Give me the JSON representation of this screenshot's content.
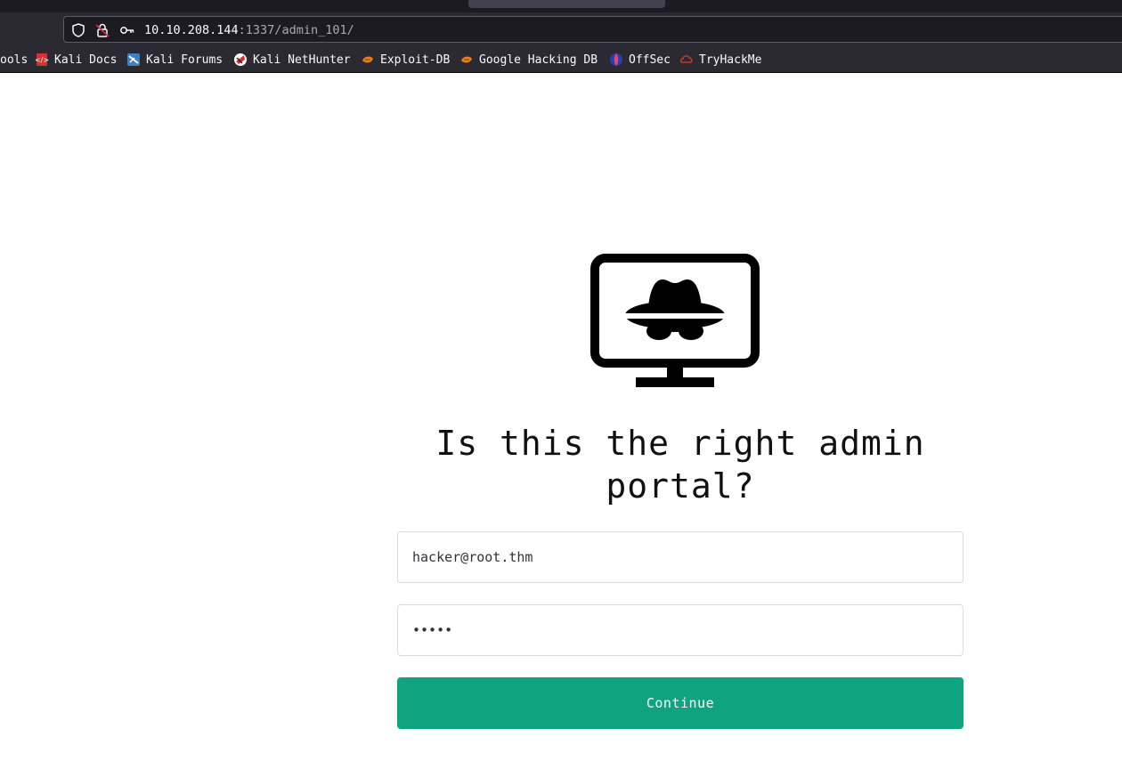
{
  "browser": {
    "url_host": "10.10.208.144",
    "url_path": ":1337/admin_101/",
    "bookmarks": [
      {
        "label": "ools",
        "icon": "tools-icon"
      },
      {
        "label": "Kali Docs",
        "icon": "kali-docs-icon"
      },
      {
        "label": "Kali Forums",
        "icon": "kali-forums-icon"
      },
      {
        "label": "Kali NetHunter",
        "icon": "kali-nethunter-icon"
      },
      {
        "label": "Exploit-DB",
        "icon": "exploit-db-icon"
      },
      {
        "label": "Google Hacking DB",
        "icon": "google-hacking-db-icon"
      },
      {
        "label": "OffSec",
        "icon": "offsec-icon"
      },
      {
        "label": "TryHackMe",
        "icon": "tryhackme-icon"
      }
    ]
  },
  "page": {
    "title": "Is this the right admin portal?",
    "email_value": "hacker@root.thm",
    "password_value": "admin",
    "continue_label": "Continue",
    "accent_color": "#10a37f"
  }
}
